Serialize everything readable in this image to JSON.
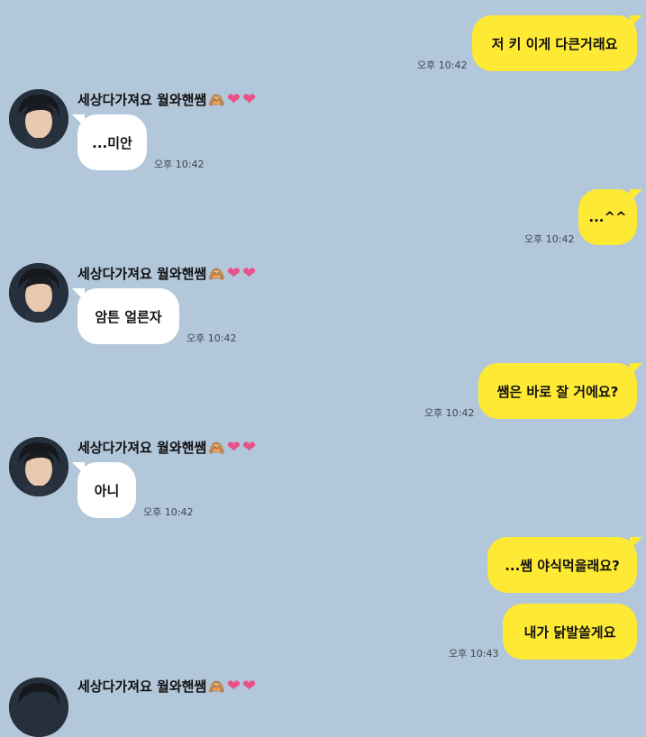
{
  "sender": {
    "name": "세상다가져요 월와핸쌤",
    "emoji": "🙈",
    "hearts": [
      "❤",
      "❤"
    ]
  },
  "messages": [
    {
      "from": "me",
      "text": "저 키 이게 다큰거래요",
      "time": "오후 10:42"
    },
    {
      "from": "other",
      "text": "...미안",
      "time": "오후 10:42"
    },
    {
      "from": "me",
      "text": "...^^",
      "time": "오후 10:42"
    },
    {
      "from": "other",
      "text": "암튼 얼른자",
      "time": "오후 10:42"
    },
    {
      "from": "me",
      "text": "쌤은 바로 잘 거에요?",
      "time": "오후 10:42"
    },
    {
      "from": "other",
      "text": "아니",
      "time": "오후 10:42"
    },
    {
      "from": "me",
      "text": "...쌤 야식먹을래요?",
      "time": ""
    },
    {
      "from": "me",
      "text": "내가 닭발쏠게요",
      "time": "오후 10:43"
    },
    {
      "from": "other",
      "text": "",
      "time": ""
    }
  ],
  "colors": {
    "background": "#b2c7da",
    "my_bubble": "#fee934",
    "other_bubble": "#ffffff",
    "heart": "#e8508a"
  }
}
